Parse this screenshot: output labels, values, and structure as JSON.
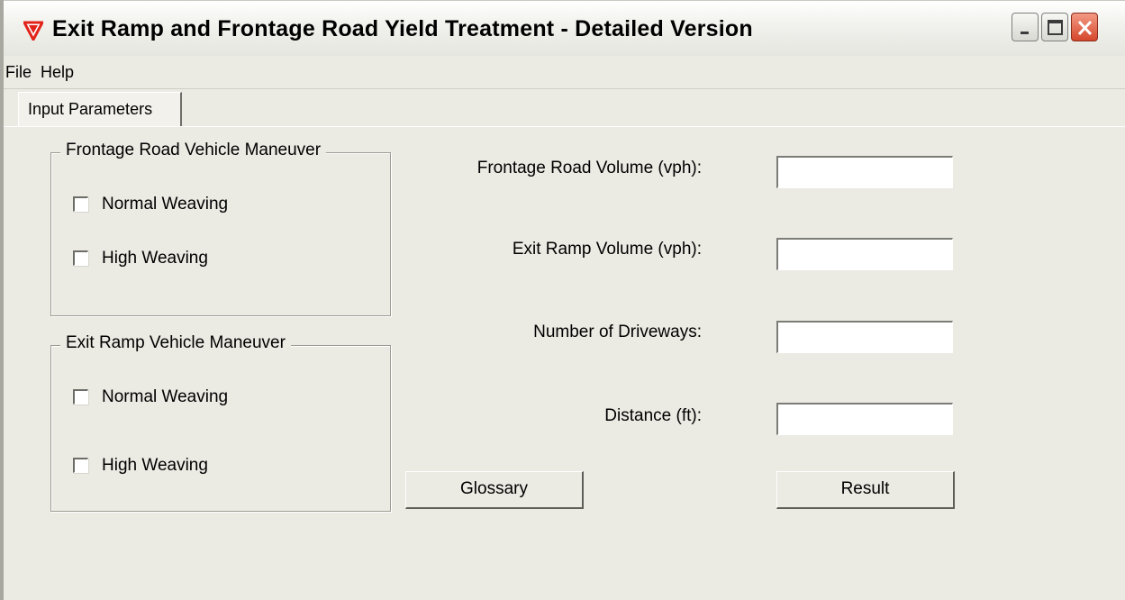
{
  "window": {
    "title": "Exit Ramp and Frontage Road Yield Treatment - Detailed Version",
    "icon": "red-triangle-icon",
    "controls": [
      "minimize",
      "maximize",
      "close"
    ]
  },
  "menu": {
    "items": [
      {
        "label": "File"
      },
      {
        "label": "Help"
      }
    ]
  },
  "tabs": [
    {
      "label": "Input Parameters",
      "selected": true
    }
  ],
  "groups": {
    "frontage": {
      "legend": "Frontage Road Vehicle Maneuver",
      "options": [
        {
          "label": "Normal Weaving",
          "checked": false
        },
        {
          "label": "High Weaving",
          "checked": false
        }
      ]
    },
    "exit_ramp": {
      "legend": "Exit Ramp Vehicle Maneuver",
      "options": [
        {
          "label": "Normal Weaving",
          "checked": false
        },
        {
          "label": "High Weaving",
          "checked": false
        }
      ]
    }
  },
  "fields": {
    "frontage_volume": {
      "label": "Frontage Road Volume (vph):",
      "value": ""
    },
    "exit_ramp_volume": {
      "label": "Exit Ramp Volume (vph):",
      "value": ""
    },
    "driveways": {
      "label": "Number of Driveways:",
      "value": ""
    },
    "distance": {
      "label": "Distance (ft):",
      "value": ""
    }
  },
  "buttons": {
    "glossary": "Glossary",
    "result": "Result"
  },
  "colors": {
    "window_bg": "#ebeae3",
    "close_button": "#d5472b",
    "app_icon": "#e2231a"
  }
}
